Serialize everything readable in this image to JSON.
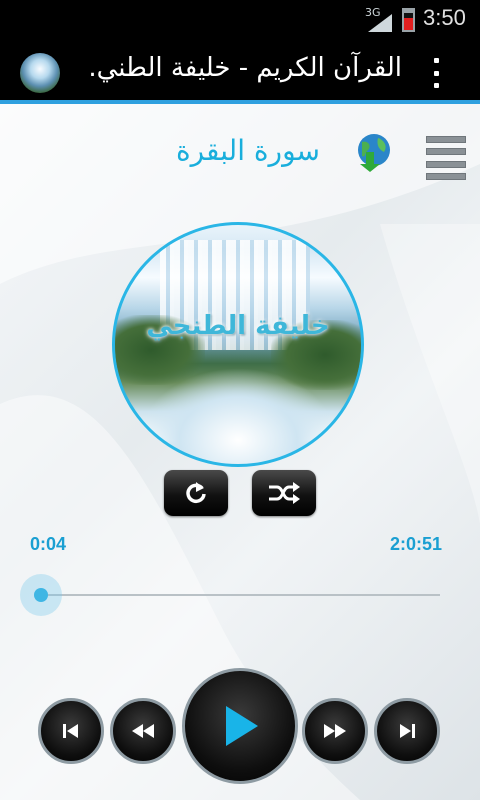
{
  "status_bar": {
    "network_type": "3G",
    "time": "3:50"
  },
  "action_bar": {
    "title": "القرآن الكريم - خليفة الطني.",
    "accent_color": "#2fa0df"
  },
  "player": {
    "surah_title": "سورة البقرة",
    "cover_caption": "خليفة الطنجي",
    "elapsed_time": "0:04",
    "total_time": "2:0:51",
    "progress_fraction": 0.0,
    "accent_color": "#19aedc"
  },
  "icons": {
    "menu": "menu-icon",
    "globe_download": "globe-download-icon",
    "repeat": "repeat-icon",
    "shuffle": "shuffle-icon",
    "previous": "skip-previous-icon",
    "rewind": "rewind-icon",
    "play": "play-icon",
    "fast_forward": "fast-forward-icon",
    "next": "skip-next-icon",
    "overflow": "overflow-menu-icon"
  }
}
